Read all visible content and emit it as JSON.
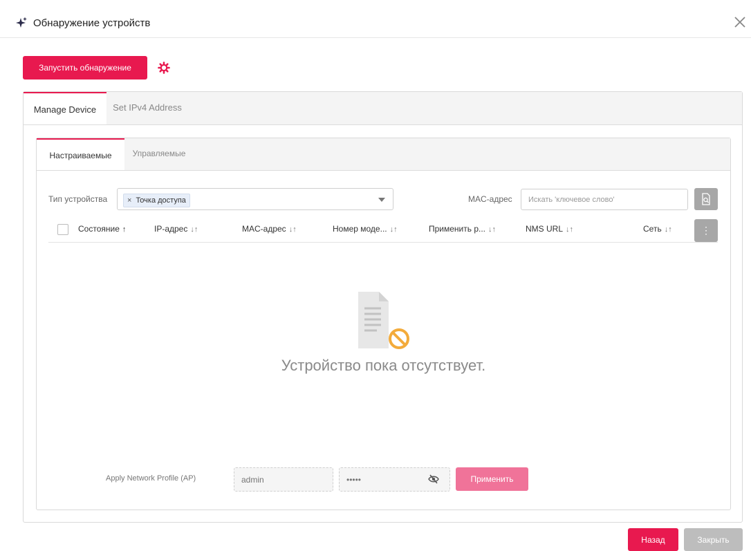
{
  "dialog": {
    "title": "Обнаружение устройств",
    "title_icon": "sparkle-icon",
    "close_icon": "close-icon"
  },
  "toolbar": {
    "start_discovery_label": "Запустить обнаружение",
    "settings_icon": "gear-icon"
  },
  "outer_tabs": [
    {
      "label": "Manage Device",
      "active": true
    },
    {
      "label": "Set IPv4 Address",
      "active": false
    }
  ],
  "inner_tabs": [
    {
      "label": "Настраиваемые",
      "active": true
    },
    {
      "label": "Управляемые",
      "active": false
    }
  ],
  "filters": {
    "device_type_label": "Тип устройства",
    "device_type_chip": "Точка доступа",
    "chip_remove": "×",
    "mac_label": "MAC-адрес",
    "search_placeholder": "Искать 'ключевое слово'"
  },
  "table": {
    "columns": [
      {
        "label": "Состояние",
        "sort": "↑"
      },
      {
        "label": "IP-адрес",
        "sort": "↓↑"
      },
      {
        "label": "MAC-адрес",
        "sort": "↓↑"
      },
      {
        "label": "Номер моде...",
        "sort": "↓↑"
      },
      {
        "label": "Применить р...",
        "sort": "↓↑"
      },
      {
        "label": "NMS URL",
        "sort": "↓↑"
      },
      {
        "label": "Сеть",
        "sort": "↓↑"
      }
    ],
    "more_icon": "⋮",
    "empty_text": "Устройство пока отсутствует."
  },
  "apply_profile": {
    "label": "Apply Network Profile (AP)",
    "username_placeholder": "admin",
    "password_placeholder": "•••••",
    "apply_label": "Применить"
  },
  "footer": {
    "back_label": "Назад",
    "close_label": "Закрыть"
  },
  "colors": {
    "accent": "#e8194f",
    "apply_disabled": "#f07399",
    "close_disabled": "#bdbdbd"
  }
}
